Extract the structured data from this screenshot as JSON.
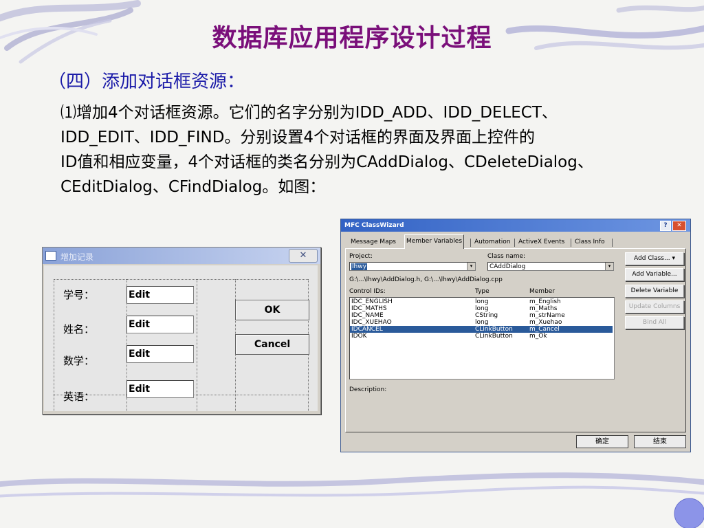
{
  "slide": {
    "title": "数据库应用程序设计过程",
    "heading": "（四）添加对话框资源：",
    "body_lines": [
      "⑴增加4个对话框资源。它们的名字分别为IDD_ADD、IDD_DELECT、",
      "IDD_EDIT、IDD_FIND。分别设置4个对话框的界面及界面上控件的",
      "ID值和相应变量，4个对话框的类名分别为CAddDialog、CDeleteDialog、",
      "CEditDialog、CFindDialog。如图："
    ]
  },
  "dialog1": {
    "title": "增加记录",
    "close_glyph": "✕",
    "labels": [
      "学号：",
      "姓名：",
      "数学：",
      "英语："
    ],
    "edit_text": "Edit",
    "ok_label": "OK",
    "cancel_label": "Cancel"
  },
  "dialog2": {
    "title": "MFC ClassWizard",
    "help_glyph": "?",
    "close_glyph": "✕",
    "tabs": [
      "Message Maps",
      "Member Variables",
      "Automation",
      "ActiveX Events",
      "Class Info"
    ],
    "project_label": "Project:",
    "project_value": "lhwy",
    "class_name_label": "Class name:",
    "class_name_value": "CAddDialog",
    "file_path": "G:\\...\\lhwy\\AddDialog.h, G:\\...\\lhwy\\AddDialog.cpp",
    "col_control_ids": "Control IDs:",
    "col_type": "Type",
    "col_member": "Member",
    "rows": [
      {
        "id": "IDC_ENGLISH",
        "type": "long",
        "member": "m_English"
      },
      {
        "id": "IDC_MATHS",
        "type": "long",
        "member": "m_Maths"
      },
      {
        "id": "IDC_NAME",
        "type": "CString",
        "member": "m_strName"
      },
      {
        "id": "IDC_XUEHAO",
        "type": "long",
        "member": "m_Xuehao"
      },
      {
        "id": "IDCANCEL",
        "type": "CLinkButton",
        "member": "m_Cancel"
      },
      {
        "id": "IDOK",
        "type": "CLinkButton",
        "member": "m_Ok"
      }
    ],
    "selected_row": 4,
    "description_label": "Description:",
    "side_buttons": [
      "Add Class...  ▾",
      "Add Variable...",
      "Delete Variable",
      "Update Columns",
      "Bind All"
    ],
    "confirm_label": "确定",
    "close_label": "结束",
    "arrow_glyph": "▾"
  },
  "colors": {
    "title": "#7a0f7a",
    "heading": "#1a1aa8",
    "selection": "#2a5a9a"
  }
}
